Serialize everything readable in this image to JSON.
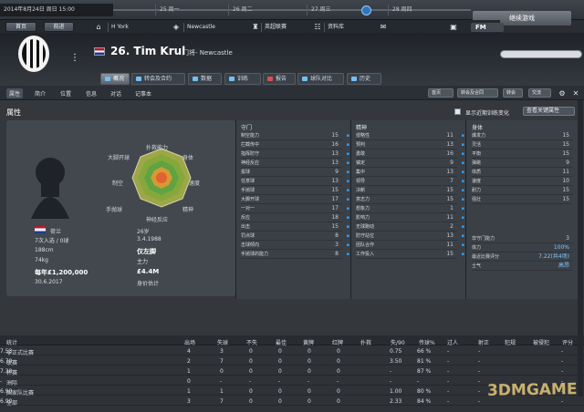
{
  "top": {
    "date": "2014年8月24日 周日 15:00",
    "days": [
      "25 周一",
      "26 周二",
      "27 周三",
      "28 周四"
    ],
    "continue": "继续游戏"
  },
  "nav": {
    "home": "首页",
    "back": "前进",
    "club": "H York",
    "team": "Newcastle",
    "league": "英超联赛",
    "data": "资料库",
    "fm": "FM"
  },
  "player": {
    "number_name": "26. Tim Krul",
    "position": "门将- Newcastle"
  },
  "tabs": [
    "概况",
    "转会及合约",
    "数据",
    "训练",
    "报告",
    "球队对比",
    "历史"
  ],
  "subnav": [
    "属性",
    "简介",
    "位置",
    "信息",
    "对话",
    "记事本"
  ],
  "subnav_right": [
    "首页",
    "转会及合同",
    "转会",
    "交流"
  ],
  "section": {
    "title": "属性",
    "show_change": "显示近期训练变化",
    "view": "查看关键属性"
  },
  "radar_labels": [
    "扑救能力",
    "身体",
    "速度",
    "精神",
    "神经反应",
    "制空",
    "大脚开球",
    "手抛球"
  ],
  "profile": {
    "nationality": "荷兰",
    "age": "26岁",
    "caps": "7次入选 / 0球",
    "birth": "3.4.1988",
    "height": "188cm",
    "status": "仅左脚",
    "weight": "74kg",
    "team_status": "主力",
    "wage": "每年£1,200,000",
    "value": "£4.4M",
    "contract": "30.6.2017",
    "value_label": "身价估计"
  },
  "attr_cols": [
    {
      "title": "守门",
      "rows": [
        [
          "制空能力",
          "15"
        ],
        [
          "拦截传中",
          "16"
        ],
        [
          "指挥防守",
          "13"
        ],
        [
          "神经反应",
          "13"
        ],
        [
          "拔球",
          "9"
        ],
        [
          "任意球",
          "13"
        ],
        [
          "手抛球",
          "15"
        ],
        [
          "大脚开球",
          "17"
        ],
        [
          "一对一",
          "17"
        ],
        [
          "反应",
          "18"
        ],
        [
          "出击",
          "15"
        ],
        [
          "罚点球",
          "8"
        ],
        [
          "击球倾向",
          "3"
        ],
        [
          "手抛球的能力",
          "8"
        ]
      ]
    },
    {
      "title": "精神",
      "rows": [
        [
          "侵略性",
          "11"
        ],
        [
          "预判",
          "13"
        ],
        [
          "勇敢",
          "16"
        ],
        [
          "镇定",
          "9"
        ],
        [
          "集中",
          "13"
        ],
        [
          "领导",
          "7"
        ],
        [
          "决断",
          "15"
        ],
        [
          "意志力",
          "15"
        ],
        [
          "想象力",
          "1"
        ],
        [
          "影响力",
          "11"
        ],
        [
          "无球跑动",
          "2"
        ],
        [
          "防守站位",
          "13"
        ],
        [
          "团队合作",
          "11"
        ],
        [
          "工作投入",
          "15"
        ]
      ]
    },
    {
      "title": "身体",
      "rows": [
        [
          "爆发力",
          "15"
        ],
        [
          "灵活",
          "15"
        ],
        [
          "平衡",
          "15"
        ],
        [
          "弹跳",
          "9"
        ],
        [
          "体质",
          "11"
        ],
        [
          "速度",
          "10"
        ],
        [
          "耐力",
          "15"
        ],
        [
          "强壮",
          "15"
        ]
      ]
    }
  ],
  "condition": {
    "injury_label": "非守门能力",
    "injury": "3",
    "status_label": "体力",
    "status": "100%",
    "value_label": "最近比赛评分",
    "value": "7.22(共4场)",
    "morale_label": "士气",
    "morale": "高昂"
  },
  "stats_head": [
    "统计",
    "出场",
    "失球",
    "不失",
    "最佳",
    "黄牌",
    "红牌",
    "扑救",
    "失/90",
    "传球%",
    "过人",
    "射正",
    "犯规",
    "被侵犯",
    "评分"
  ],
  "stats_rows": [
    [
      "非正式比赛",
      "4",
      "3",
      "0",
      "0",
      "0",
      "0",
      "0.75",
      "66 %",
      "-",
      "-",
      "-",
      "7.53"
    ],
    [
      "联赛",
      "2",
      "7",
      "0",
      "0",
      "0",
      "0",
      "3.50",
      "81 %",
      "-",
      "-",
      "-",
      "6.70"
    ],
    [
      "杯赛",
      "1",
      "0",
      "0",
      "0",
      "0",
      "0",
      "-",
      "87 %",
      "-",
      "-",
      "-",
      "7.30"
    ],
    [
      "洲际",
      "0",
      "-",
      "-",
      "-",
      "-",
      "-",
      "-",
      "-",
      "-",
      "-",
      "-",
      "-"
    ],
    [
      "国家队比赛",
      "1",
      "1",
      "0",
      "0",
      "0",
      "0",
      "1.00",
      "80 %",
      "-",
      "-",
      "-",
      "6.90"
    ],
    [
      "全部",
      "3",
      "7",
      "0",
      "0",
      "0",
      "0",
      "2.33",
      "84 %",
      "-",
      "-",
      "-",
      "6.90"
    ]
  ],
  "watermark": "3DMGAME"
}
